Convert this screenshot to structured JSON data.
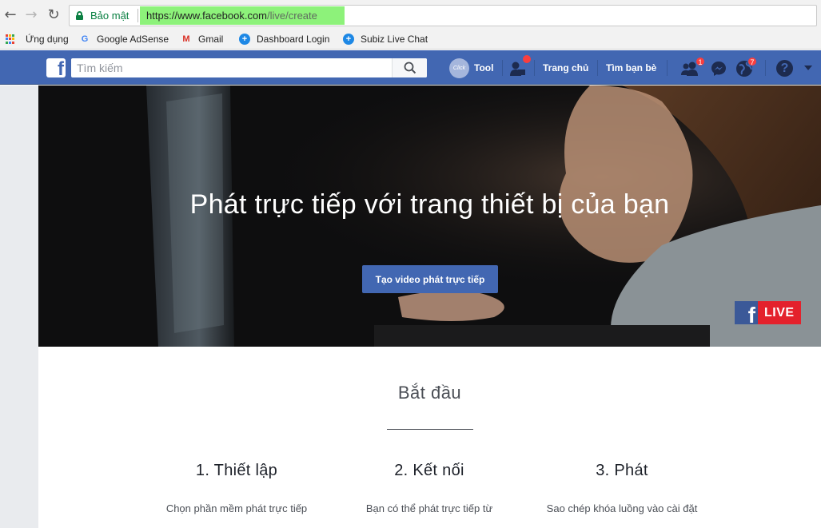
{
  "browser": {
    "secure_label": "Bảo mật",
    "url_host": "https://www.facebook.com",
    "url_path": "/live/create",
    "bookmarks": [
      {
        "label": "Ứng dụng",
        "icon": "apps-grid-icon"
      },
      {
        "label": "Google AdSense",
        "icon": "google-icon"
      },
      {
        "label": "Gmail",
        "icon": "gmail-icon"
      },
      {
        "label": "Dashboard Login",
        "icon": "plus-circle-icon"
      },
      {
        "label": "Subiz Live Chat",
        "icon": "plus-circle-icon"
      }
    ]
  },
  "fb_nav": {
    "search_placeholder": "Tìm kiếm",
    "tool_circle_text": "Click",
    "tool_label": "Tool",
    "home_label": "Trang chủ",
    "find_friends_label": "Tìm bạn bè",
    "friend_requests_count": "1",
    "notifications_count": "7",
    "help_icon": "?"
  },
  "hero": {
    "title": "Phát trực tiếp với trang thiết bị của bạn",
    "button_label": "Tạo video phát trực tiếp",
    "live_badge_f": "f",
    "live_badge_text": "LIVE"
  },
  "content": {
    "section_title": "Bắt đầu",
    "steps": [
      {
        "title": "1. Thiết lập",
        "text": "Chọn phần mềm phát trực tiếp"
      },
      {
        "title": "2. Kết nối",
        "text": "Bạn có thể phát trực tiếp từ"
      },
      {
        "title": "3. Phát",
        "text": "Sao chép khóa luồng vào cài đặt"
      }
    ]
  },
  "colors": {
    "fb_blue": "#4267b2",
    "secure_green": "#0b8043",
    "url_highlight": "#8df27a",
    "live_red": "#e4212c",
    "badge_red": "#fa3e3e"
  }
}
